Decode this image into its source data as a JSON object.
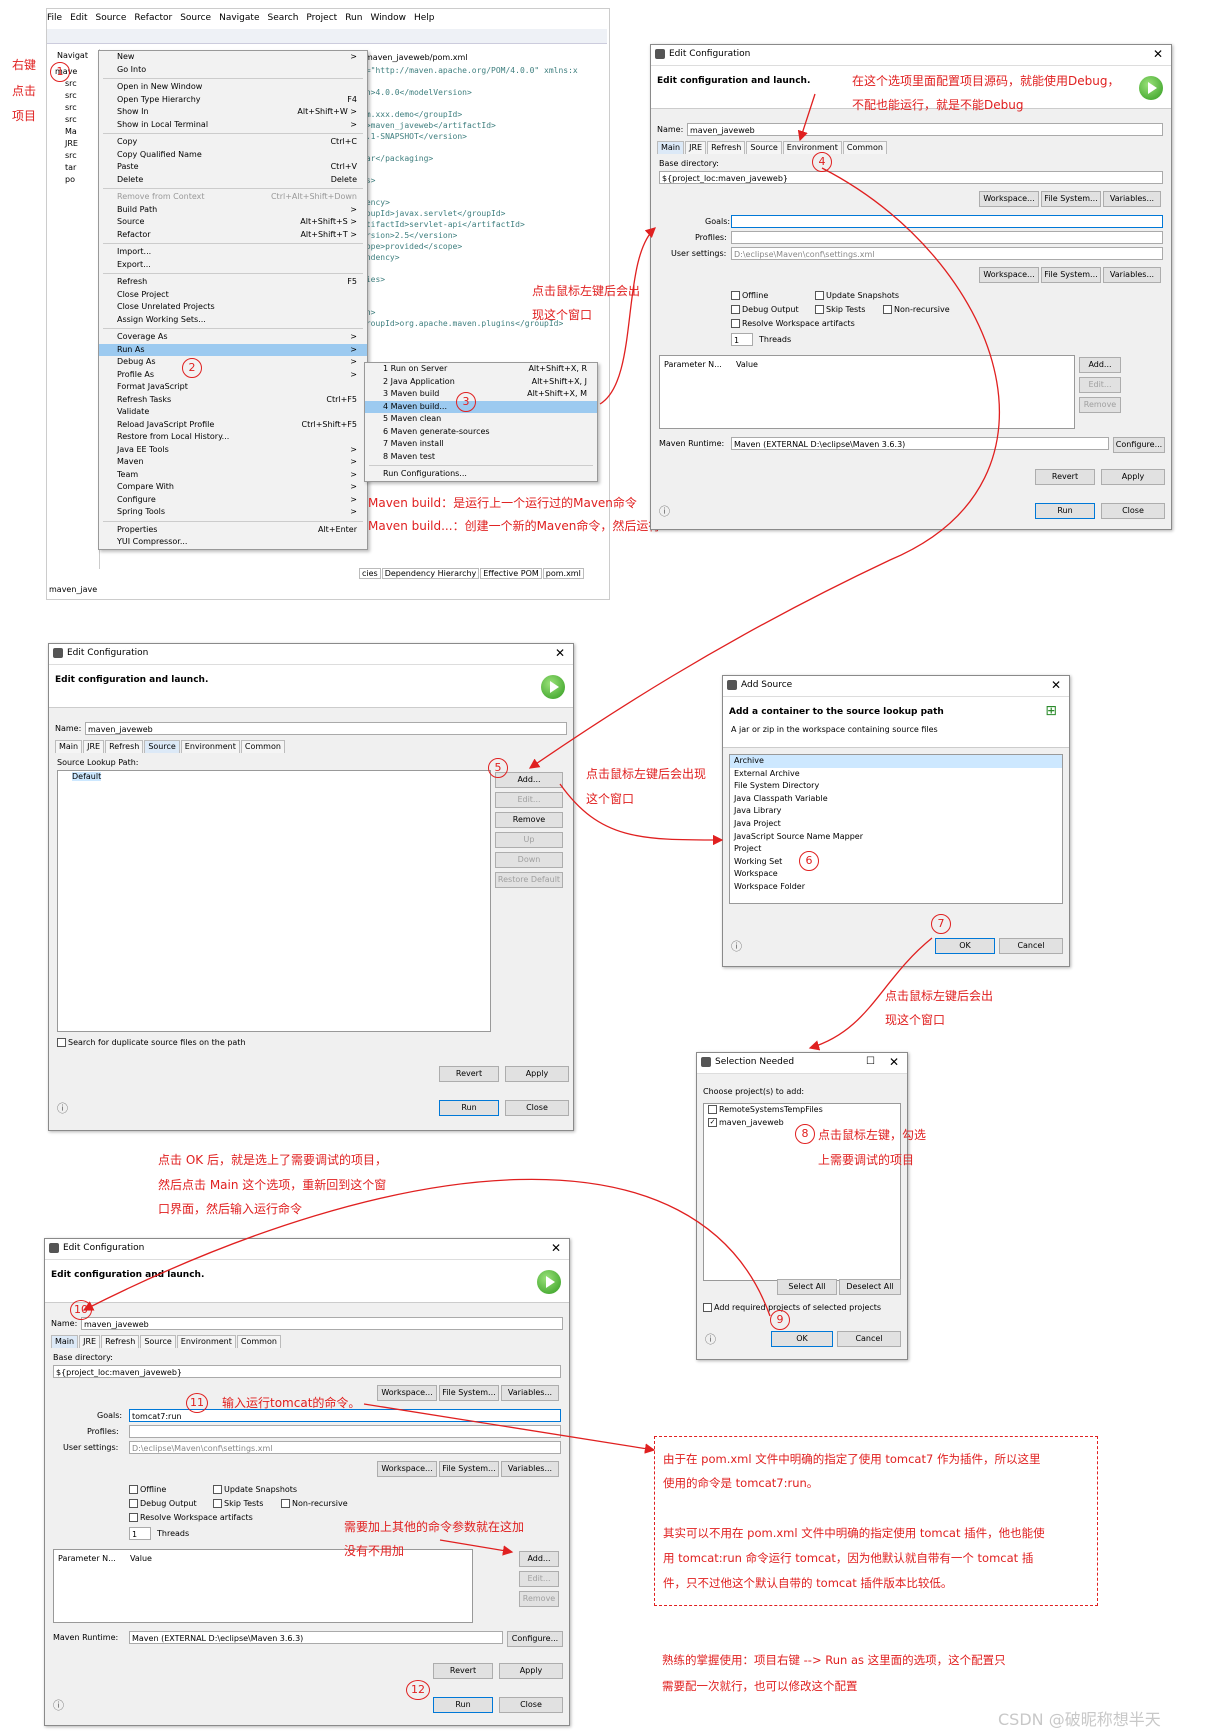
{
  "eclipse": {
    "menubar": [
      "File",
      "Edit",
      "Source",
      "Refactor",
      "Source",
      "Navigate",
      "Search",
      "Project",
      "Run",
      "Window",
      "Help"
    ],
    "navigator_tab": "Navigat",
    "tree": [
      "mave",
      "src",
      "src",
      "src",
      "src",
      "Ma",
      "JRE",
      "src",
      "tar",
      "po"
    ],
    "editor_tab": "maven_javeweb/pom.xml",
    "editor_lines": [
      "s=\"http://maven.apache.org/POM/4.0.0\" xmlns:x",
      "",
      "on>4.0.0</modelVersion>",
      "",
      "om.xxx.demo</groupId>",
      "t>maven_javeweb</artifactId>",
      "0.1-SNAPSHOT</version>",
      "",
      "war</packaging>",
      "",
      "es>",
      "",
      "dency>",
      "roupId>javax.servlet</groupId>",
      "rtifactId>servlet-api</artifactId>",
      "ersion>2.5</version>",
      "cope>provided</scope>",
      "endency>",
      "",
      "cies>",
      "",
      "",
      "in>",
      "groupId>org.apache.maven.plugins</groupId>"
    ],
    "bottom_tabs": [
      "cies",
      "Dependency Hierarchy",
      "Effective POM",
      "pom.xml"
    ],
    "status": "maven_jave",
    "context_menu": [
      {
        "l": "New",
        "s": ">"
      },
      {
        "l": "Go Into",
        "s": ""
      },
      {
        "sep": true
      },
      {
        "l": "Open in New Window",
        "s": ""
      },
      {
        "l": "Open Type Hierarchy",
        "s": "F4"
      },
      {
        "l": "Show In",
        "s": "Alt+Shift+W >"
      },
      {
        "l": "Show in Local Terminal",
        "s": ">"
      },
      {
        "sep": true
      },
      {
        "l": "Copy",
        "s": "Ctrl+C"
      },
      {
        "l": "Copy Qualified Name",
        "s": ""
      },
      {
        "l": "Paste",
        "s": "Ctrl+V"
      },
      {
        "l": "Delete",
        "s": "Delete"
      },
      {
        "sep": true
      },
      {
        "l": "Remove from Context",
        "s": "Ctrl+Alt+Shift+Down",
        "dis": true
      },
      {
        "l": "Build Path",
        "s": ">"
      },
      {
        "l": "Source",
        "s": "Alt+Shift+S >"
      },
      {
        "l": "Refactor",
        "s": "Alt+Shift+T >"
      },
      {
        "sep": true
      },
      {
        "l": "Import...",
        "s": ""
      },
      {
        "l": "Export...",
        "s": ""
      },
      {
        "sep": true
      },
      {
        "l": "Refresh",
        "s": "F5"
      },
      {
        "l": "Close Project",
        "s": ""
      },
      {
        "l": "Close Unrelated Projects",
        "s": ""
      },
      {
        "l": "Assign Working Sets...",
        "s": ""
      },
      {
        "sep": true
      },
      {
        "l": "Coverage As",
        "s": ">"
      },
      {
        "l": "Run As",
        "s": ">",
        "hl": true
      },
      {
        "l": "Debug As",
        "s": ">"
      },
      {
        "l": "Profile As",
        "s": ">"
      },
      {
        "l": "Format JavaScript",
        "s": ""
      },
      {
        "l": "Refresh Tasks",
        "s": "Ctrl+F5"
      },
      {
        "l": "Validate",
        "s": ""
      },
      {
        "l": "Reload JavaScript Profile",
        "s": "Ctrl+Shift+F5"
      },
      {
        "l": "Restore from Local History...",
        "s": ""
      },
      {
        "l": "Java EE Tools",
        "s": ">"
      },
      {
        "l": "Maven",
        "s": ">"
      },
      {
        "l": "Team",
        "s": ">"
      },
      {
        "l": "Compare With",
        "s": ">"
      },
      {
        "l": "Configure",
        "s": ">"
      },
      {
        "l": "Spring Tools",
        "s": ">"
      },
      {
        "sep": true
      },
      {
        "l": "Properties",
        "s": "Alt+Enter"
      },
      {
        "l": "YUI Compressor...",
        "s": ""
      }
    ],
    "run_menu": [
      {
        "l": "1 Run on Server",
        "s": "Alt+Shift+X, R"
      },
      {
        "l": "2 Java Application",
        "s": "Alt+Shift+X, J"
      },
      {
        "l": "3 Maven build",
        "s": "Alt+Shift+X, M"
      },
      {
        "l": "4 Maven build...",
        "s": "",
        "hl": true
      },
      {
        "l": "5 Maven clean",
        "s": ""
      },
      {
        "l": "6 Maven generate-sources",
        "s": ""
      },
      {
        "l": "7 Maven install",
        "s": ""
      },
      {
        "l": "8 Maven test",
        "s": ""
      },
      {
        "sep": true
      },
      {
        "l": "Run Configurations...",
        "s": ""
      }
    ]
  },
  "notes": {
    "right_click": [
      "右键",
      "点击",
      "项目"
    ],
    "config_source": "在这个选项里面配置项目源码，就能使用Debug，",
    "config_source2": "不配也能运行，就是不能Debug",
    "left_click_1": "点击鼠标左键后会出",
    "left_click_1b": "现这个窗口",
    "maven_build_1": "Maven build：是运行上一个运行过的Maven命令",
    "maven_build_2": "Maven build...：创建一个新的Maven命令，然后运行",
    "left_click_2": "点击鼠标左键后会出现",
    "left_click_2b": "这个窗口",
    "left_click_3": "点击鼠标左键后会出",
    "left_click_3b": "现这个窗口",
    "select_1": "点击鼠标左键，勾选",
    "select_2": "上需要调试的项目",
    "after_ok_1": "点击 OK 后，就是选上了需要调试的项目，",
    "after_ok_2": "然后点击 Main 这个选项，重新回到这个窗",
    "after_ok_3": "口界面，然后输入运行命令",
    "goals_note": "输入运行tomcat的命令。",
    "params_1": "需要加上其他的命令参数就在这加",
    "params_2": "没有不用加",
    "box_1": "由于在 pom.xml 文件中明确的指定了使用 tomcat7 作为插件，所以这里",
    "box_2": "使用的命令是 tomcat7:run。",
    "box_3": "其实可以不用在 pom.xml 文件中明确的指定使用 tomcat 插件，他也能使",
    "box_4": "用 tomcat:run 命令运行 tomcat，因为他默认就自带有一个 tomcat 插",
    "box_5": "件，只不过他这个默认自带的 tomcat 插件版本比较低。",
    "final_1": "熟练的掌握使用：项目右键 --> Run as 这里面的选项，这个配置只",
    "final_2": "需要配一次就行，也可以修改这个配置",
    "watermark": "CSDN @破昵称想半天"
  },
  "steps": [
    "1",
    "2",
    "3",
    "4",
    "5",
    "6",
    "7",
    "8",
    "9",
    "10",
    "11",
    "12"
  ],
  "edit_config": {
    "title": "Edit Configuration",
    "header": "Edit configuration and launch.",
    "name_label": "Name:",
    "name": "maven_javeweb",
    "tabs": [
      "Main",
      "JRE",
      "Refresh",
      "Source",
      "Environment",
      "Common"
    ],
    "base_dir_label": "Base directory:",
    "base_dir": "${project_loc:maven_javeweb}",
    "workspace": "Workspace...",
    "filesystem": "File System...",
    "variables": "Variables...",
    "goals_label": "Goals:",
    "goals_value": "tomcat7:run",
    "profiles_label": "Profiles:",
    "user_settings_label": "User settings:",
    "user_settings": "D:\\eclipse\\Maven\\conf\\settings.xml",
    "offline": "Offline",
    "update_snapshots": "Update Snapshots",
    "debug_output": "Debug Output",
    "skip_tests": "Skip Tests",
    "non_recursive": "Non-recursive",
    "resolve_ws": "Resolve Workspace artifacts",
    "threads_val": "1",
    "threads": "Threads",
    "param_name": "Parameter N...",
    "param_value": "Value",
    "add": "Add...",
    "edit": "Edit...",
    "remove": "Remove",
    "runtime_label": "Maven Runtime:",
    "runtime": "Maven (EXTERNAL D:\\eclipse\\Maven 3.6.3)",
    "configure": "Configure...",
    "revert": "Revert",
    "apply": "Apply",
    "run": "Run",
    "close": "Close",
    "source_lookup": "Source Lookup Path:",
    "default": "Default",
    "up": "Up",
    "down": "Down",
    "restore": "Restore Default",
    "search_dup": "Search for duplicate source files on the path"
  },
  "add_source": {
    "title": "Add Source",
    "header": "Add a container to the source lookup path",
    "desc": "A jar or zip in the workspace containing source files",
    "items": [
      "Archive",
      "External Archive",
      "File System Directory",
      "Java Classpath Variable",
      "Java Library",
      "Java Project",
      "JavaScript Source Name Mapper",
      "Project",
      "Working Set",
      "Workspace",
      "Workspace Folder"
    ],
    "ok": "OK",
    "cancel": "Cancel"
  },
  "selection": {
    "title": "Selection Needed",
    "label": "Choose project(s) to add:",
    "items": [
      "RemoteSystemsTempFiles",
      "maven_javeweb"
    ],
    "select_all": "Select All",
    "deselect_all": "Deselect All",
    "add_required": "Add required projects of selected projects",
    "ok": "OK",
    "cancel": "Cancel"
  }
}
